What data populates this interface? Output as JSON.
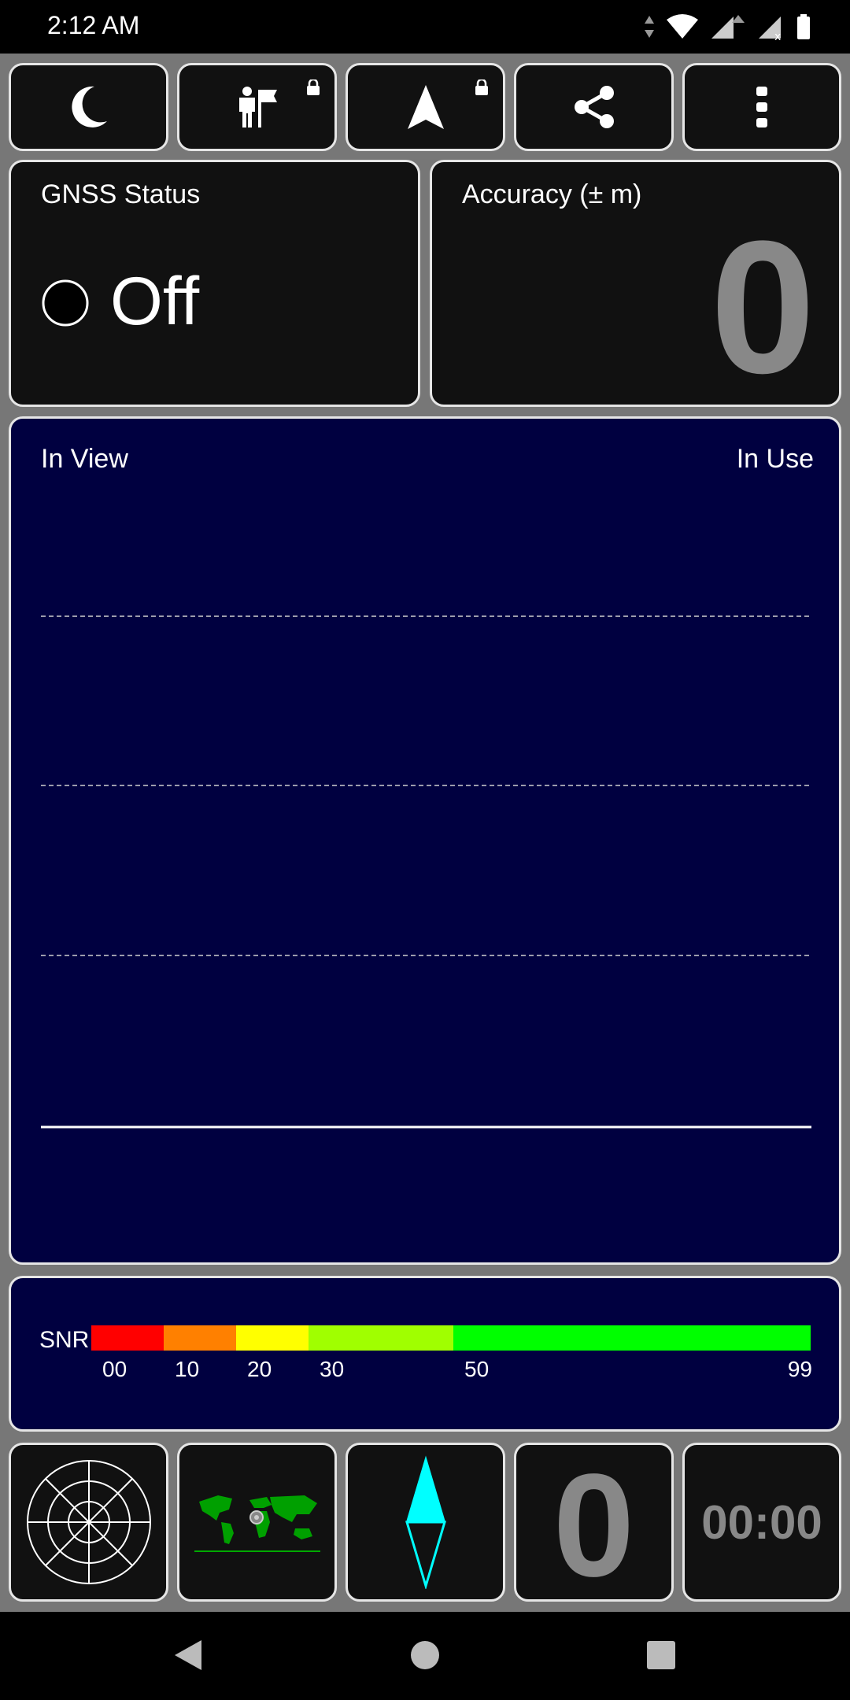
{
  "status_bar": {
    "time": "2:12 AM",
    "icons": [
      "data-arrows-icon",
      "wifi-icon",
      "signal-icon",
      "signal-no-service-icon",
      "battery-icon"
    ]
  },
  "toolbar": {
    "buttons": [
      {
        "name": "night-mode-button",
        "icon": "moon-icon",
        "locked": false
      },
      {
        "name": "waypoint-button",
        "icon": "person-flag-icon",
        "locked": true
      },
      {
        "name": "navigate-button",
        "icon": "navigation-arrow-icon",
        "locked": true
      },
      {
        "name": "share-button",
        "icon": "share-icon",
        "locked": false
      },
      {
        "name": "more-options-button",
        "icon": "more-vertical-icon",
        "locked": false
      }
    ]
  },
  "gnss_status": {
    "title": "GNSS Status",
    "value": "Off"
  },
  "accuracy": {
    "title": "Accuracy (± m)",
    "value": "0"
  },
  "satellite_chart": {
    "left_label": "In View",
    "right_label": "In Use"
  },
  "snr": {
    "label": "SNR",
    "ticks": [
      "00",
      "10",
      "20",
      "30",
      "50",
      "99"
    ],
    "colors": [
      "#ff0000",
      "#ff8000",
      "#ffff00",
      "#a0ff00",
      "#00ff00"
    ]
  },
  "bottom_tiles": {
    "radar_icon": "sky-plot-icon",
    "map_icon": "world-map-icon",
    "compass_icon": "compass-needle-icon",
    "satellites_count": "0",
    "timer": "00:00"
  },
  "nav_bar": {
    "icons": [
      "back-icon",
      "home-icon",
      "recents-icon"
    ]
  }
}
